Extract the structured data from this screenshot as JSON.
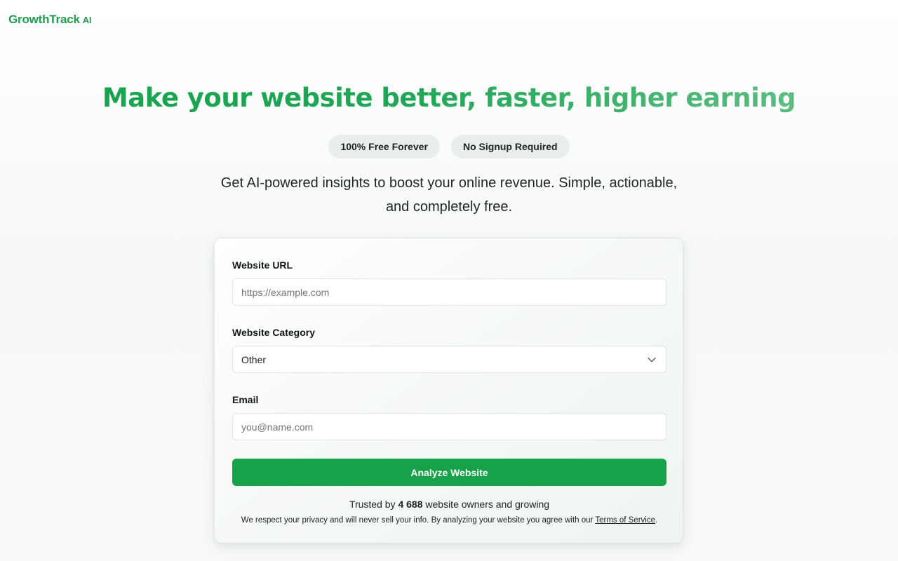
{
  "brand": {
    "name": "GrowthTrack",
    "suffix": "AI",
    "color": "#1e9e4d"
  },
  "hero": {
    "title": "Make your website better, faster, higher earning",
    "badges": [
      "100% Free Forever",
      "No Signup Required"
    ],
    "subtitle": "Get AI-powered insights to boost your online revenue. Simple, actionable, and completely free."
  },
  "form": {
    "url": {
      "label": "Website URL",
      "placeholder": "https://example.com",
      "value": ""
    },
    "category": {
      "label": "Website Category",
      "selected": "Other",
      "icon": "chevron-down-icon"
    },
    "email": {
      "label": "Email",
      "placeholder": "you@name.com",
      "value": ""
    },
    "submit_label": "Analyze Website",
    "button_color": "#17a24a"
  },
  "trust": {
    "prefix": "Trusted by",
    "count": "4 688",
    "suffix": "website owners and growing"
  },
  "privacy": {
    "text": "We respect your privacy and will never sell your info. By analyzing your website you agree with our",
    "link": "Terms of Service",
    "end": "."
  }
}
